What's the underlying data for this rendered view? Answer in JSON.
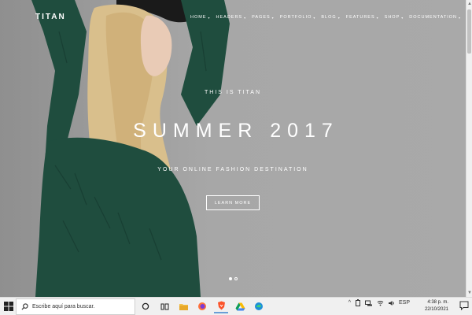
{
  "site": {
    "brand": "TITAN",
    "nav": [
      "HOME",
      "HEADERS",
      "PAGES",
      "PORTFOLIO",
      "BLOG",
      "FEATURES",
      "SHOP",
      "DOCUMENTATION"
    ],
    "hero": {
      "kicker": "THIS IS TITAN",
      "title": "SUMMER 2017",
      "tagline": "YOUR ONLINE FASHION DESTINATION",
      "cta": "LEARN MORE"
    }
  },
  "taskbar": {
    "search_placeholder": "Escribe aquí para buscar.",
    "lang": "ESP",
    "time": "4:38 p. m.",
    "date": "22/10/2021"
  },
  "colors": {
    "hero_gray": "#a7a7a7",
    "sweater_green": "#1f4d3e",
    "hair_blonde": "#d9bf8c"
  }
}
